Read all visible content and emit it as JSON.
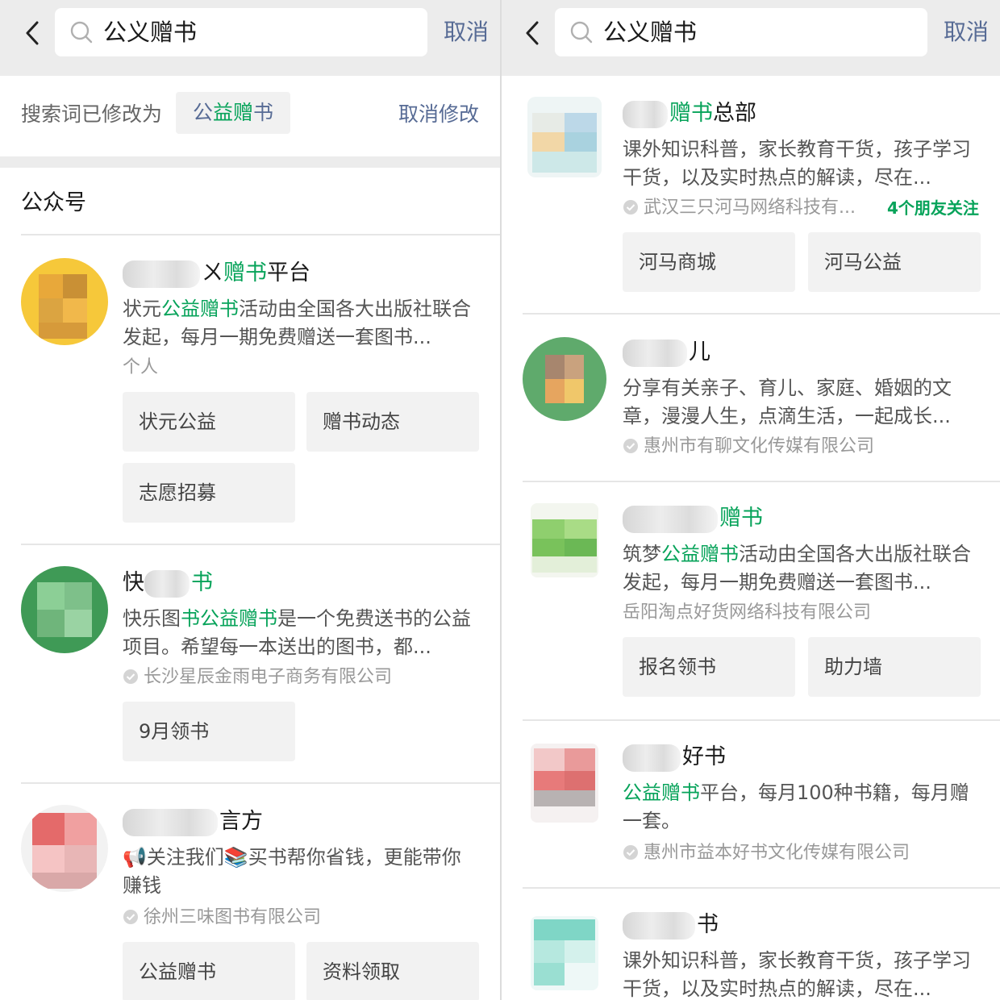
{
  "left": {
    "search_query": "公义赠书",
    "cancel_label": "取消",
    "revise": {
      "prefix": "搜索词已修改为",
      "chip_plain_1": "公",
      "chip_highlight": "益赠",
      "chip_plain_2": "书",
      "cancel_revise": "取消修改"
    },
    "section_title": "公众号",
    "accounts": [
      {
        "name_suffix_plain_1": "ㄨ",
        "name_highlight": "赠书",
        "name_suffix_plain_2": "平台",
        "desc_plain_1": "状元",
        "desc_highlight": "公益赠书",
        "desc_plain_2": "活动由全国各大出版社联合发起，每月一期免费赠送一套图书...",
        "meta": "个人",
        "menu": [
          "状元公益",
          "赠书动态",
          "志愿招募"
        ]
      },
      {
        "name_prefix": "快",
        "name_highlight": "书",
        "desc_plain_1": "快乐图",
        "desc_highlight_1": "书",
        "desc_highlight_2": "公益赠书",
        "desc_plain_2": "是一个免费送书的公益项目。希望每一本送出的图书，都...",
        "meta": "长沙星辰金雨电子商务有限公司",
        "menu": [
          "9月领书"
        ]
      },
      {
        "name_suffix": "言方",
        "desc": "📢关注我们📚买书帮你省钱，更能带你赚钱",
        "meta": "徐州三味图书有限公司",
        "menu": [
          "公益赠书",
          "资料领取"
        ]
      }
    ]
  },
  "right": {
    "search_query": "公义赠书",
    "cancel_label": "取消",
    "accounts": [
      {
        "name_highlight": "赠书",
        "name_suffix": "总部",
        "desc": "课外知识科普，家长教育干货，孩子学习干货，以及实时热点的解读，尽在...",
        "meta": "武汉三只河马网络科技有...",
        "friends": "4个朋友关注",
        "menu": [
          "河马商城",
          "河马公益"
        ]
      },
      {
        "name_suffix": "儿",
        "desc": "分享有关亲子、育儿、家庭、婚姻的文章，漫漫人生，点滴生活，一起成长...",
        "meta": "惠州市有聊文化传媒有限公司"
      },
      {
        "name_highlight": "赠书",
        "desc_plain_1": "筑梦",
        "desc_highlight": "公益赠书",
        "desc_plain_2": "活动由全国各大出版社联合发起，每月一期免费赠送一套图书...",
        "meta": "岳阳淘点好货网络科技有限公司",
        "menu": [
          "报名领书",
          "助力墙"
        ]
      },
      {
        "name_suffix": "好书",
        "desc_highlight": "公益赠书",
        "desc_plain": "平台，每月100种书籍，每月赠一套。",
        "meta": "惠州市益本好书文化传媒有限公司"
      },
      {
        "name_suffix": "书",
        "desc": "课外知识科普，家长教育干货，孩子学习干货，以及实时热点的解读，尽在..."
      }
    ]
  },
  "icons": {
    "back": "chevron-left-icon",
    "search": "search-icon",
    "verified": "verified-badge-icon"
  },
  "colors": {
    "highlight": "#07a35a",
    "link": "#576b95",
    "topbar": "#ececec",
    "button_bg": "#f2f2f2"
  }
}
